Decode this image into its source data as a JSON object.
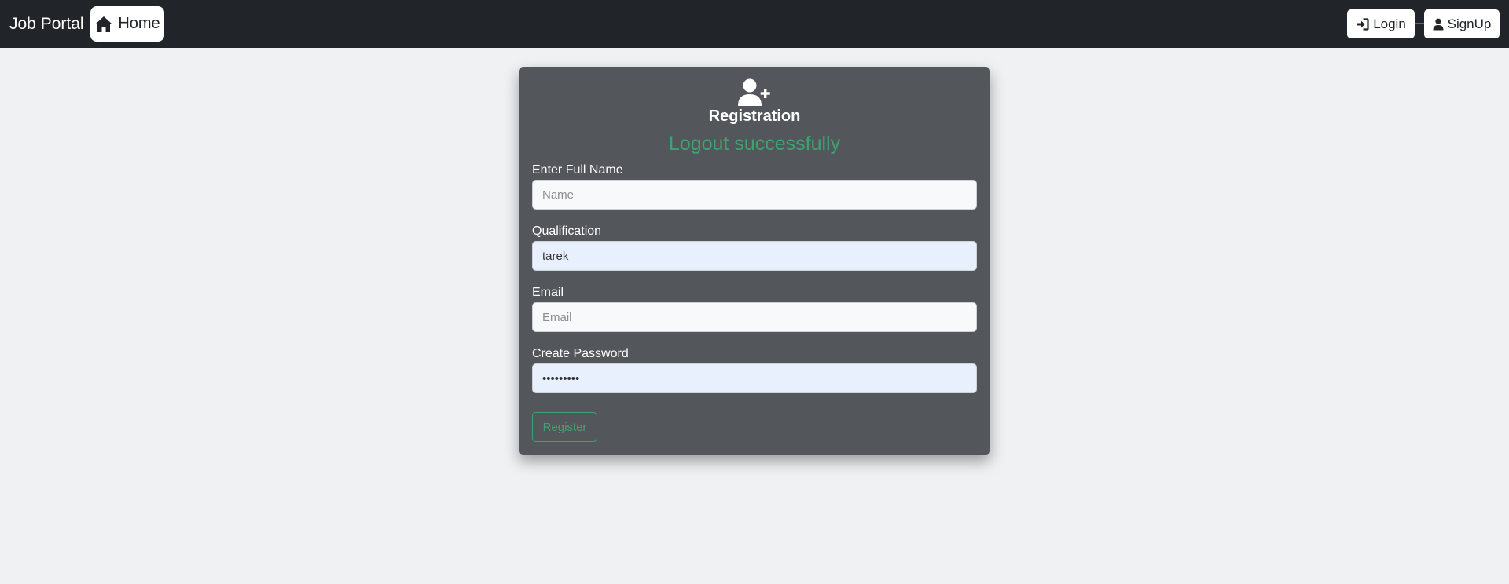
{
  "navbar": {
    "brand": "Job Portal",
    "home_label": "Home",
    "login_label": "Login",
    "signup_label": "SignUp"
  },
  "registration": {
    "title": "Registration",
    "status_message": "Logout successfully",
    "full_name": {
      "label": "Enter Full Name",
      "placeholder": "Name",
      "value": ""
    },
    "qualification": {
      "label": "Qualification",
      "placeholder": "",
      "value": "tarek"
    },
    "email": {
      "label": "Email",
      "placeholder": "Email",
      "value": ""
    },
    "password": {
      "label": "Create Password",
      "placeholder": "",
      "value": "•••••••••"
    },
    "register_label": "Register"
  },
  "colors": {
    "navbar_bg": "#212529",
    "page_bg": "#f0f1f3",
    "card_bg": "#53575b",
    "success_green": "#3fa371",
    "autofill_bg": "#e8f0fe"
  },
  "icons": {
    "home": "home-icon",
    "login": "sign-in-icon",
    "signup": "user-icon",
    "register": "user-plus-icon"
  }
}
